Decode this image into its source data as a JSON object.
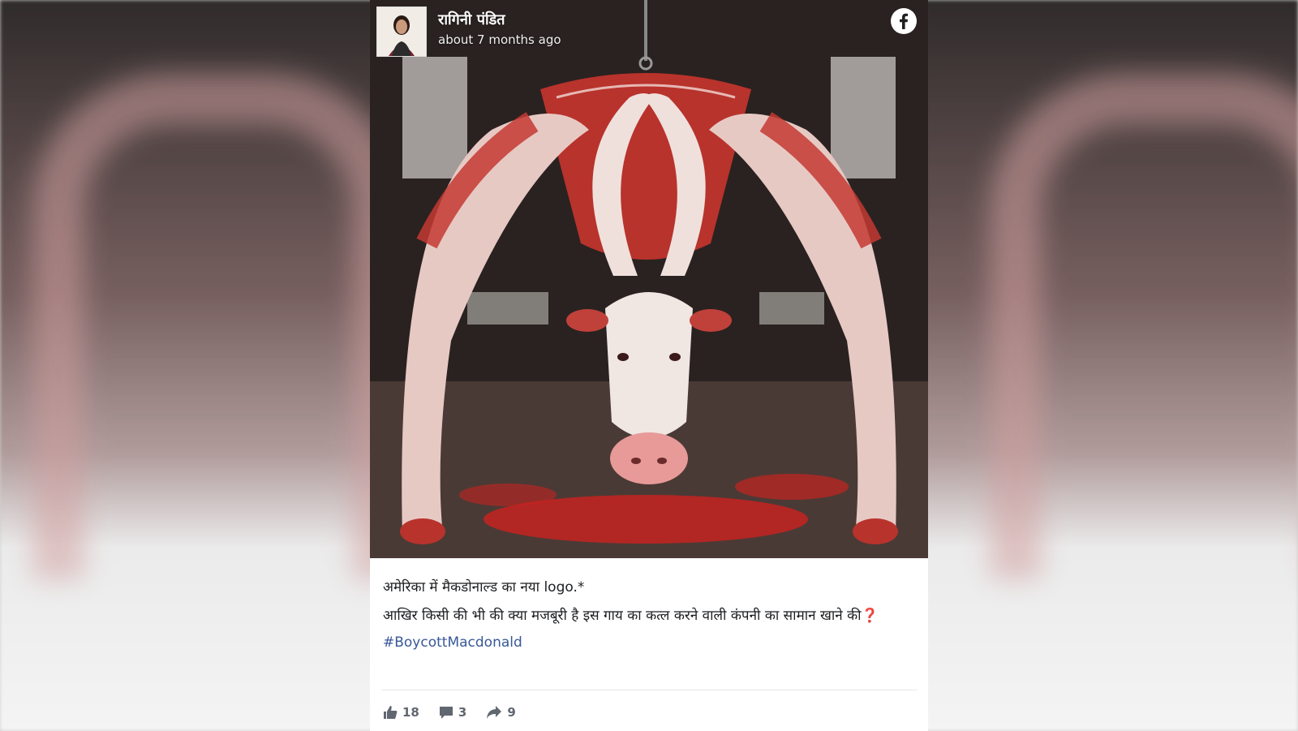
{
  "post": {
    "author": "रागिनी पंडित",
    "timestamp": "about 7 months ago",
    "platform_icon": "facebook-icon",
    "text_line1": "अमेरिका में मैकडोनाल्ड का नया logo.*",
    "text_line2": "आखिर किसी की भी की क्या मजबूरी है इस गाय का कत्ल करने वाली कंपनी का सामान खाने की❓",
    "hashtag": "#BoycottMacdonald",
    "image_description_icon": "cow-carcass-arch-image"
  },
  "actions": {
    "likes": "18",
    "comments": "3",
    "shares": "9"
  },
  "colors": {
    "hashtag": "#385898",
    "meat_red": "#b8332c",
    "text": "#1c1e21",
    "muted": "#606770"
  }
}
